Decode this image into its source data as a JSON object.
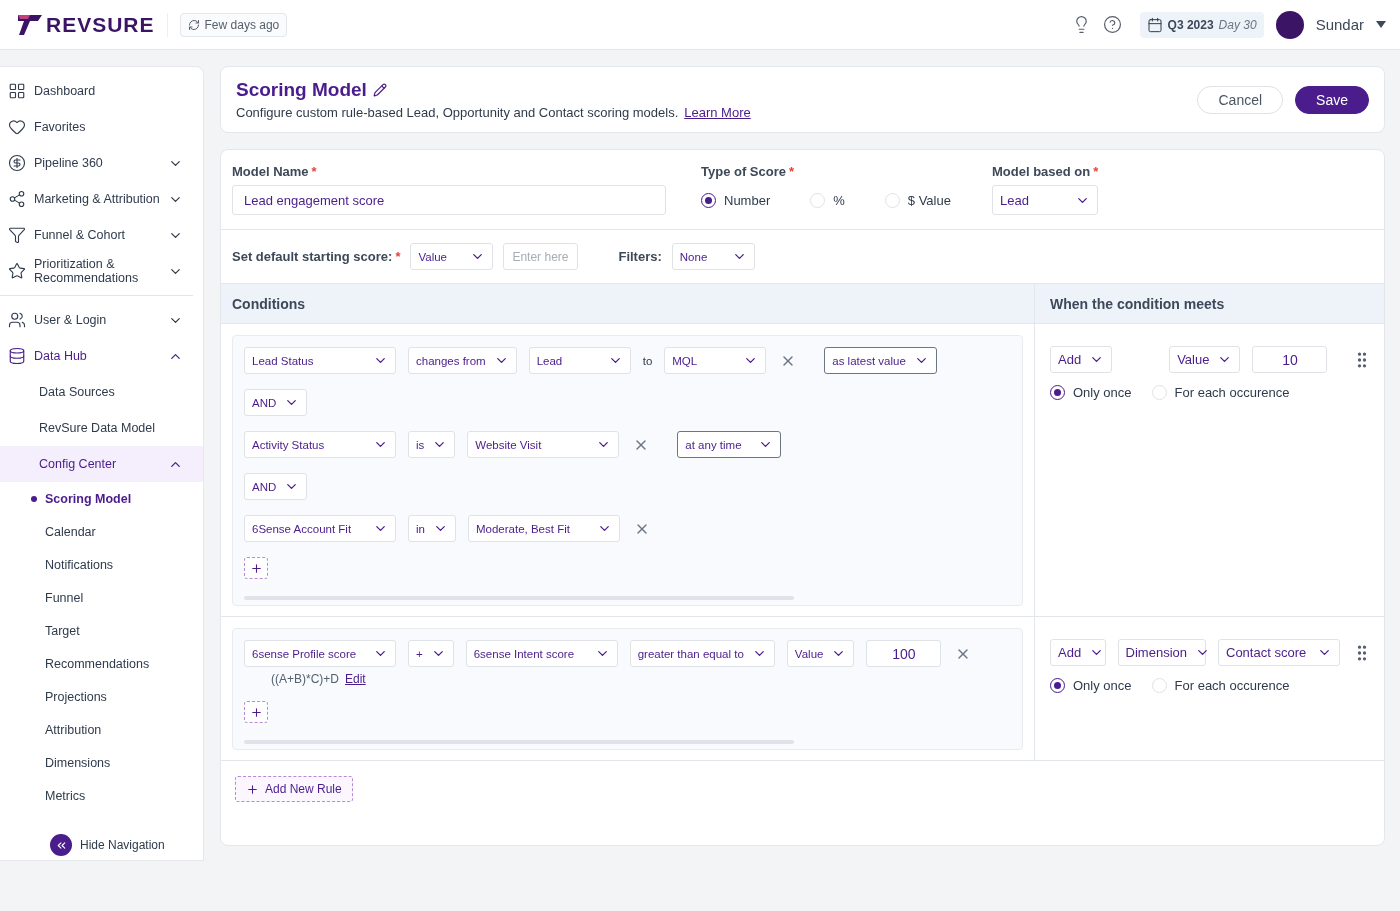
{
  "header": {
    "logo": "REVSURE",
    "refresh": "Few days ago",
    "period": {
      "quarter": "Q3 2023",
      "day": "Day 30"
    },
    "user": "Sundar"
  },
  "sidebar": {
    "sections": [
      {
        "items": [
          {
            "label": "Dashboard",
            "selected": false
          },
          {
            "label": "Favorites",
            "selected": false
          },
          {
            "label": "Pipeline 360",
            "expanded": false
          },
          {
            "label": "Marketing & Attribution",
            "expanded": false
          },
          {
            "label": "Funnel & Cohort",
            "expanded": false
          },
          {
            "label": "Prioritization & Recommendations",
            "expanded": false
          }
        ]
      },
      {
        "items": [
          {
            "label": "User & Login",
            "expanded": false
          },
          {
            "label": "Data Hub",
            "expanded": true,
            "children": [
              {
                "label": "Data Sources",
                "selected": false
              },
              {
                "label": "RevSure Data Model",
                "selected": false
              },
              {
                "label": "Config Center",
                "expanded": true,
                "children": [
                  {
                    "label": "Scoring Model",
                    "selected": true
                  },
                  {
                    "label": "Calendar",
                    "selected": false
                  },
                  {
                    "label": "Notifications",
                    "selected": false
                  },
                  {
                    "label": "Funnel",
                    "selected": false
                  },
                  {
                    "label": "Target",
                    "selected": false
                  },
                  {
                    "label": "Recommendations",
                    "selected": false
                  },
                  {
                    "label": "Projections",
                    "selected": false
                  },
                  {
                    "label": "Attribution",
                    "selected": false
                  },
                  {
                    "label": "Dimensions",
                    "selected": false
                  },
                  {
                    "label": "Metrics",
                    "selected": false
                  }
                ]
              }
            ]
          }
        ]
      }
    ],
    "hide_navigation": "Hide Navigation"
  },
  "page": {
    "title": "Scoring Model",
    "description": "Configure custom rule-based Lead, Opportunity and Contact scoring models.",
    "learn_more": "Learn More",
    "cancel": "Cancel",
    "save": "Save"
  },
  "form": {
    "model_name": {
      "label": "Model Name",
      "required_mark": "*",
      "value": "Lead engagement score"
    },
    "type_of_score": {
      "label": "Type of Score",
      "required_mark": "*",
      "options": [
        {
          "label": "Number",
          "selected": true
        },
        {
          "label": "%",
          "selected": false
        },
        {
          "label": "$ Value",
          "selected": false
        }
      ]
    },
    "model_based_on": {
      "label": "Model based on",
      "required_mark": "*",
      "value": "Lead"
    },
    "default_score": {
      "label": "Set default starting score:",
      "required_mark": "*",
      "mode": "Value",
      "placeholder": "Enter here"
    },
    "filters": {
      "label": "Filters:",
      "value": "None"
    }
  },
  "table": {
    "conditions_header": "Conditions",
    "actions_header": "When the condition meets",
    "rules": [
      {
        "conditions": [
          {
            "kind": "condition",
            "parts": [
              {
                "kind": "field",
                "value": "Lead Status"
              },
              {
                "kind": "operator",
                "value": "changes from"
              },
              {
                "kind": "value",
                "value": "Lead"
              },
              {
                "kind": "word",
                "value": "to"
              },
              {
                "kind": "value",
                "value": "MQL"
              },
              {
                "kind": "remove"
              },
              {
                "kind": "timing",
                "value": "as latest value"
              }
            ]
          },
          {
            "kind": "connector",
            "value": "AND"
          },
          {
            "kind": "condition",
            "parts": [
              {
                "kind": "field",
                "value": "Activity Status"
              },
              {
                "kind": "operator",
                "value": "is"
              },
              {
                "kind": "wide_value",
                "value": "Website Visit"
              },
              {
                "kind": "remove"
              },
              {
                "kind": "timing",
                "value": "at any time"
              }
            ]
          },
          {
            "kind": "connector",
            "value": "AND"
          },
          {
            "kind": "condition",
            "parts": [
              {
                "kind": "field",
                "value": "6Sense Account Fit"
              },
              {
                "kind": "operator",
                "value": "in"
              },
              {
                "kind": "wide_value",
                "value": "Moderate, Best Fit"
              },
              {
                "kind": "remove"
              }
            ]
          }
        ],
        "action": {
          "parts": [
            {
              "kind": "operation",
              "value": "Add"
            },
            {
              "kind": "spacer"
            },
            {
              "kind": "select",
              "value": "Value"
            },
            {
              "kind": "input",
              "value": "10"
            }
          ],
          "frequency": [
            {
              "label": "Only once",
              "selected": true
            },
            {
              "label": "For each occurence",
              "selected": false
            }
          ]
        }
      },
      {
        "conditions": [
          {
            "kind": "condition",
            "parts": [
              {
                "kind": "field",
                "value": "6sense Profile score"
              },
              {
                "kind": "operator",
                "value": "+"
              },
              {
                "kind": "wide_value",
                "value": "6sense Intent score"
              },
              {
                "kind": "operator",
                "value": "greater than equal to"
              },
              {
                "kind": "operator",
                "value": "Value"
              },
              {
                "kind": "input",
                "value": "100"
              },
              {
                "kind": "remove"
              }
            ]
          },
          {
            "kind": "formula",
            "value": "((A+B)*C)+D",
            "link": "Edit"
          }
        ],
        "action": {
          "parts": [
            {
              "kind": "operation",
              "value": "Add"
            },
            {
              "kind": "select",
              "value": "Dimension"
            },
            {
              "kind": "wide_select",
              "value": "Contact score"
            }
          ],
          "frequency": [
            {
              "label": "Only once",
              "selected": true
            },
            {
              "label": "For each occurence",
              "selected": false
            }
          ]
        }
      }
    ],
    "add_rule": "Add New Rule"
  }
}
